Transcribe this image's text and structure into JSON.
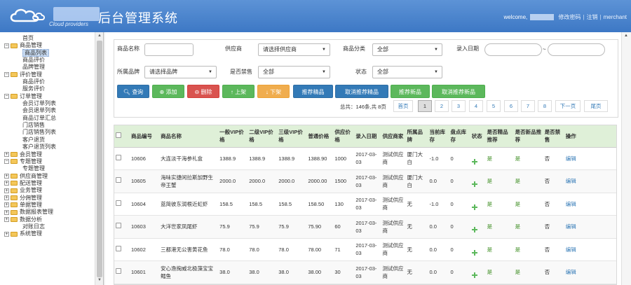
{
  "header": {
    "brand_text": "Cloud providers",
    "system_title": "后台管理系统",
    "welcome_label": "welcome,",
    "change_password": "修改密码",
    "logout": "注销",
    "merchant": "merchant",
    "colors": {
      "header_bg": "#4a86cd"
    }
  },
  "sidebar": {
    "items": [
      {
        "label": "首页",
        "level": 0,
        "type": "home"
      },
      {
        "label": "商品管理",
        "level": 0,
        "type": "folder",
        "expanded": true
      },
      {
        "label": "商品列表",
        "level": 1,
        "type": "leaf",
        "selected": true
      },
      {
        "label": "商品评价",
        "level": 1,
        "type": "leaf"
      },
      {
        "label": "品牌管理",
        "level": 1,
        "type": "leaf"
      },
      {
        "label": "评价管理",
        "level": 0,
        "type": "folder",
        "expanded": true
      },
      {
        "label": "商品评价",
        "level": 1,
        "type": "leaf"
      },
      {
        "label": "服务评价",
        "level": 1,
        "type": "leaf"
      },
      {
        "label": "订单管理",
        "level": 0,
        "type": "folder",
        "expanded": true
      },
      {
        "label": "会员订单列表",
        "level": 1,
        "type": "leaf"
      },
      {
        "label": "会员退单列表",
        "level": 1,
        "type": "leaf"
      },
      {
        "label": "商品订单汇总",
        "level": 1,
        "type": "leaf"
      },
      {
        "label": "门店销售",
        "level": 1,
        "type": "leaf"
      },
      {
        "label": "门店销售列表",
        "level": 1,
        "type": "leaf"
      },
      {
        "label": "客户退货",
        "level": 1,
        "type": "leaf"
      },
      {
        "label": "客户退货列表",
        "level": 1,
        "type": "leaf"
      },
      {
        "label": "会员管理",
        "level": 0,
        "type": "folder",
        "expanded": false
      },
      {
        "label": "专题管理",
        "level": 0,
        "type": "folder",
        "expanded": true
      },
      {
        "label": "专题管理",
        "level": 1,
        "type": "leaf"
      },
      {
        "label": "供应商管理",
        "level": 0,
        "type": "folder",
        "expanded": false
      },
      {
        "label": "配送管理",
        "level": 0,
        "type": "folder",
        "expanded": false
      },
      {
        "label": "业务管理",
        "level": 0,
        "type": "folder",
        "expanded": false
      },
      {
        "label": "分佣管理",
        "level": 0,
        "type": "folder",
        "expanded": false
      },
      {
        "label": "单据管理",
        "level": 0,
        "type": "folder",
        "expanded": false
      },
      {
        "label": "数据报表管理",
        "level": 0,
        "type": "folder",
        "expanded": false
      },
      {
        "label": "数据分析",
        "level": 0,
        "type": "folder",
        "expanded": false
      },
      {
        "label": "对账日志",
        "level": 1,
        "type": "leaf"
      },
      {
        "label": "系统管理",
        "level": 0,
        "type": "folder",
        "expanded": false
      }
    ]
  },
  "search": {
    "product_name_label": "商品名称",
    "product_name_value": "",
    "supplier_label": "供应商",
    "supplier_value": "请选择供应商",
    "category_label": "商品分类",
    "category_value": "全部",
    "date_label": "录入日期",
    "date_sep": "~",
    "brand_label": "所属品牌",
    "brand_value": "请选择品牌",
    "banned_label": "是否禁售",
    "banned_value": "全部",
    "status_label": "状态",
    "status_value": "全部"
  },
  "toolbar": {
    "query": "查询",
    "add": "添加",
    "delete": "删除",
    "on_shelf": "上架",
    "off_shelf": "下架",
    "recommend_premium": "推荐精品",
    "cancel_premium": "取消推荐精品",
    "recommend_new": "推荐新品",
    "cancel_new": "取消推荐新品"
  },
  "pagination": {
    "total_text": "总共：146条,共 8页",
    "first": "首页",
    "pages": [
      "1",
      "2",
      "3",
      "4",
      "5",
      "6",
      "7",
      "8"
    ],
    "current": "1",
    "next": "下一页",
    "last": "尾页"
  },
  "table": {
    "columns": [
      "",
      "商品编号",
      "商品名称",
      "一般VIP价格",
      "二级VIP价格",
      "三级VIP价格",
      "普通价格",
      "供应价格",
      "录入日期",
      "供应商家",
      "所属品牌",
      "当前库存",
      "盘点库存",
      "状态",
      "是否精品推荐",
      "是否新品推荐",
      "是否禁售",
      "操作"
    ],
    "rows": [
      {
        "id": "10606",
        "name": "大连淡干海参礼盒",
        "vip1": "1388.9",
        "vip2": "1388.9",
        "vip3": "1388.9",
        "price": "1388.90",
        "supply": "1000",
        "date": "2017-03-03",
        "supplier": "测试供应商",
        "brand": "厦门大白",
        "stock": "-1.0",
        "check": "0",
        "premium": "是",
        "newp": "是",
        "banned": "否",
        "op": "编辑"
      },
      {
        "id": "10605",
        "name": "海味实捷闲拉斯加野生帝王蟹",
        "vip1": "2000.0",
        "vip2": "2000.0",
        "vip3": "2000.0",
        "price": "2000.00",
        "supply": "1500",
        "date": "2017-03-03",
        "supplier": "测试供应商",
        "brand": "厦门大白",
        "stock": "0.0",
        "check": "0",
        "premium": "是",
        "newp": "是",
        "banned": "否",
        "op": "编辑"
      },
      {
        "id": "10604",
        "name": "蓝简彼东润根近虹虾",
        "vip1": "158.5",
        "vip2": "158.5",
        "vip3": "158.5",
        "price": "158.50",
        "supply": "130",
        "date": "2017-03-03",
        "supplier": "测试供应商",
        "brand": "无",
        "stock": "-1.0",
        "check": "0",
        "premium": "是",
        "newp": "是",
        "banned": "否",
        "op": "编辑"
      },
      {
        "id": "10603",
        "name": "大洋世家凤尾虾",
        "vip1": "75.9",
        "vip2": "75.9",
        "vip3": "75.9",
        "price": "75.90",
        "supply": "60",
        "date": "2017-03-03",
        "supplier": "测试供应商",
        "brand": "无",
        "stock": "0.0",
        "check": "0",
        "premium": "是",
        "newp": "是",
        "banned": "否",
        "op": "编辑"
      },
      {
        "id": "10602",
        "name": "三都港无公害黄花鱼",
        "vip1": "78.0",
        "vip2": "78.0",
        "vip3": "78.0",
        "price": "78.00",
        "supply": "71",
        "date": "2017-03-03",
        "supplier": "测试供应商",
        "brand": "无",
        "stock": "0.0",
        "check": "0",
        "premium": "是",
        "newp": "是",
        "banned": "否",
        "op": "编辑"
      },
      {
        "id": "10601",
        "name": "安心渔掬威北极藻宝宝鳕鱼",
        "vip1": "38.0",
        "vip2": "38.0",
        "vip3": "38.0",
        "price": "38.00",
        "supply": "30",
        "date": "2017-03-03",
        "supplier": "测试供应商",
        "brand": "无",
        "stock": "0.0",
        "check": "0",
        "premium": "是",
        "newp": "是",
        "banned": "否",
        "op": "编辑"
      }
    ]
  }
}
